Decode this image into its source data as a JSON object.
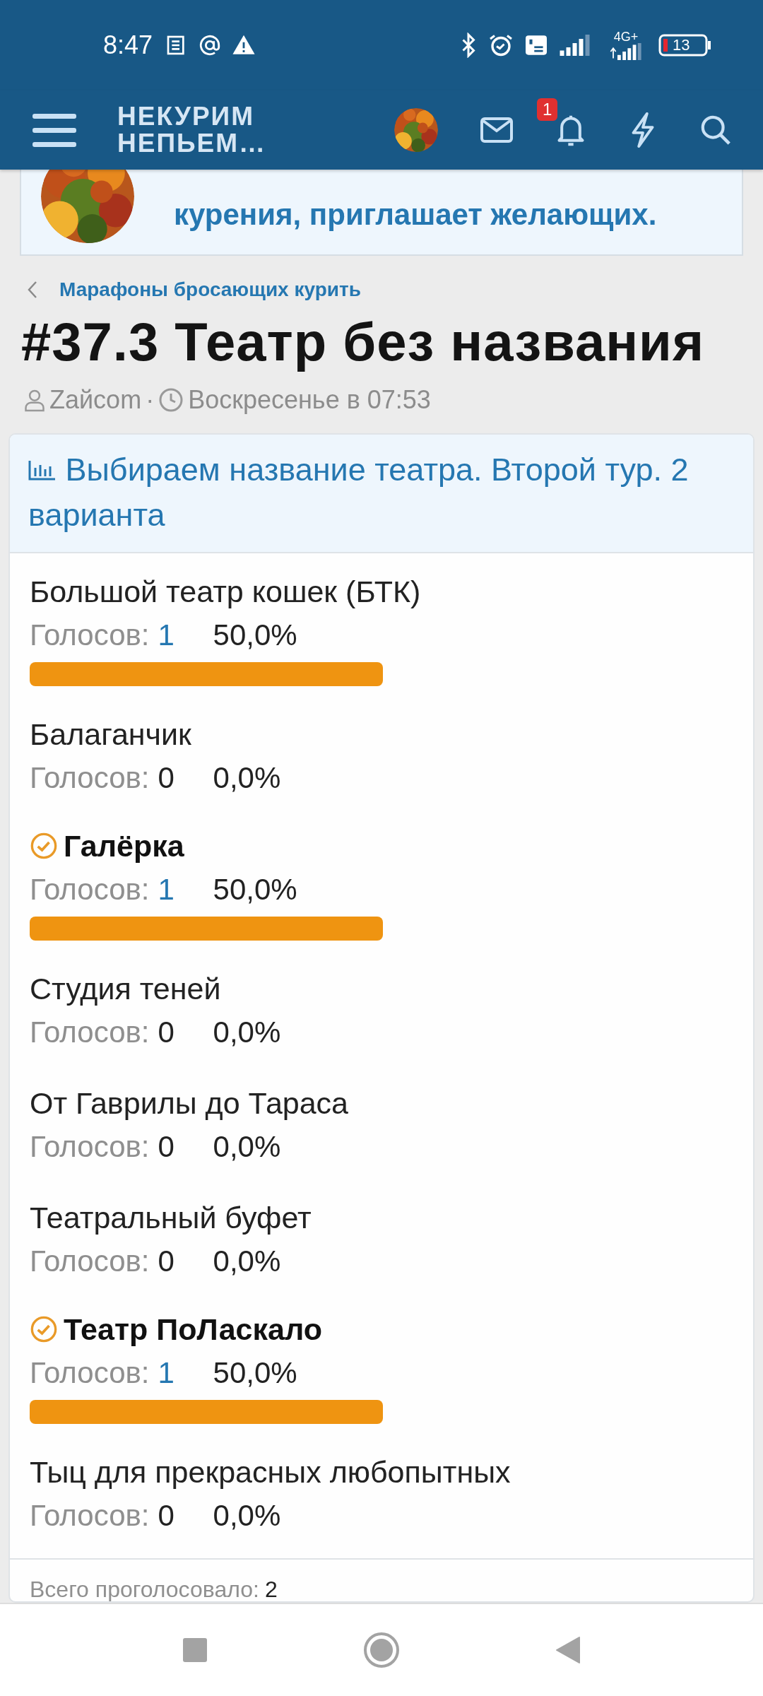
{
  "status_bar": {
    "time": "8:47",
    "battery": "13",
    "network": "4G+"
  },
  "header": {
    "logo_lines": [
      "НЕКУРИМ",
      "НЕПЬЕМ…"
    ],
    "notification_badge": "1"
  },
  "banner": {
    "text": "курения, приглашает желающих."
  },
  "breadcrumb": {
    "label": "Марафоны бросающих курить"
  },
  "thread": {
    "title": "#37.3 Театр без названия",
    "author": "Zaйcom",
    "separator": "·",
    "date": "Воскресенье в 07:53"
  },
  "poll": {
    "question": "Выбираем название театра. Второй тур. 2 варианта",
    "options": [
      {
        "name": "Большой театр кошек (БТК)",
        "selected": false,
        "votes_label": "Голосов:",
        "votes": "1",
        "votes_link": true,
        "percent": "50,0%",
        "bar": true
      },
      {
        "name": "Балаганчик",
        "selected": false,
        "votes_label": "Голосов:",
        "votes": "0",
        "votes_link": false,
        "percent": "0,0%",
        "bar": false
      },
      {
        "name": "Галёрка",
        "selected": true,
        "votes_label": "Голосов:",
        "votes": "1",
        "votes_link": true,
        "percent": "50,0%",
        "bar": true
      },
      {
        "name": "Студия теней",
        "selected": false,
        "votes_label": "Голосов:",
        "votes": "0",
        "votes_link": false,
        "percent": "0,0%",
        "bar": false
      },
      {
        "name": "От Гаврилы до Тараса",
        "selected": false,
        "votes_label": "Голосов:",
        "votes": "0",
        "votes_link": false,
        "percent": "0,0%",
        "bar": false
      },
      {
        "name": "Театральный буфет",
        "selected": false,
        "votes_label": "Голосов:",
        "votes": "0",
        "votes_link": false,
        "percent": "0,0%",
        "bar": false
      },
      {
        "name": "Театр ПоЛаскало",
        "selected": true,
        "votes_label": "Голосов:",
        "votes": "1",
        "votes_link": true,
        "percent": "50,0%",
        "bar": true
      },
      {
        "name": "Тыц для прекрасных любопытных",
        "selected": false,
        "votes_label": "Голосов:",
        "votes": "0",
        "votes_link": false,
        "percent": "0,0%",
        "bar": false
      }
    ],
    "total_label": "Всего проголосовало:",
    "total": "2"
  }
}
